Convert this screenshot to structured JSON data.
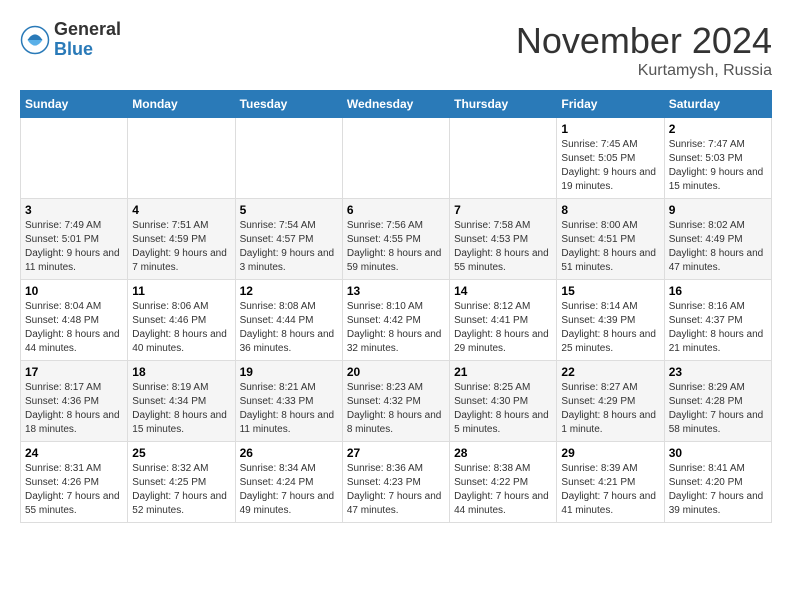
{
  "logo": {
    "general": "General",
    "blue": "Blue"
  },
  "title": "November 2024",
  "location": "Kurtamysh, Russia",
  "days_of_week": [
    "Sunday",
    "Monday",
    "Tuesday",
    "Wednesday",
    "Thursday",
    "Friday",
    "Saturday"
  ],
  "weeks": [
    [
      {
        "day": "",
        "info": ""
      },
      {
        "day": "",
        "info": ""
      },
      {
        "day": "",
        "info": ""
      },
      {
        "day": "",
        "info": ""
      },
      {
        "day": "",
        "info": ""
      },
      {
        "day": "1",
        "info": "Sunrise: 7:45 AM\nSunset: 5:05 PM\nDaylight: 9 hours and 19 minutes."
      },
      {
        "day": "2",
        "info": "Sunrise: 7:47 AM\nSunset: 5:03 PM\nDaylight: 9 hours and 15 minutes."
      }
    ],
    [
      {
        "day": "3",
        "info": "Sunrise: 7:49 AM\nSunset: 5:01 PM\nDaylight: 9 hours and 11 minutes."
      },
      {
        "day": "4",
        "info": "Sunrise: 7:51 AM\nSunset: 4:59 PM\nDaylight: 9 hours and 7 minutes."
      },
      {
        "day": "5",
        "info": "Sunrise: 7:54 AM\nSunset: 4:57 PM\nDaylight: 9 hours and 3 minutes."
      },
      {
        "day": "6",
        "info": "Sunrise: 7:56 AM\nSunset: 4:55 PM\nDaylight: 8 hours and 59 minutes."
      },
      {
        "day": "7",
        "info": "Sunrise: 7:58 AM\nSunset: 4:53 PM\nDaylight: 8 hours and 55 minutes."
      },
      {
        "day": "8",
        "info": "Sunrise: 8:00 AM\nSunset: 4:51 PM\nDaylight: 8 hours and 51 minutes."
      },
      {
        "day": "9",
        "info": "Sunrise: 8:02 AM\nSunset: 4:49 PM\nDaylight: 8 hours and 47 minutes."
      }
    ],
    [
      {
        "day": "10",
        "info": "Sunrise: 8:04 AM\nSunset: 4:48 PM\nDaylight: 8 hours and 44 minutes."
      },
      {
        "day": "11",
        "info": "Sunrise: 8:06 AM\nSunset: 4:46 PM\nDaylight: 8 hours and 40 minutes."
      },
      {
        "day": "12",
        "info": "Sunrise: 8:08 AM\nSunset: 4:44 PM\nDaylight: 8 hours and 36 minutes."
      },
      {
        "day": "13",
        "info": "Sunrise: 8:10 AM\nSunset: 4:42 PM\nDaylight: 8 hours and 32 minutes."
      },
      {
        "day": "14",
        "info": "Sunrise: 8:12 AM\nSunset: 4:41 PM\nDaylight: 8 hours and 29 minutes."
      },
      {
        "day": "15",
        "info": "Sunrise: 8:14 AM\nSunset: 4:39 PM\nDaylight: 8 hours and 25 minutes."
      },
      {
        "day": "16",
        "info": "Sunrise: 8:16 AM\nSunset: 4:37 PM\nDaylight: 8 hours and 21 minutes."
      }
    ],
    [
      {
        "day": "17",
        "info": "Sunrise: 8:17 AM\nSunset: 4:36 PM\nDaylight: 8 hours and 18 minutes."
      },
      {
        "day": "18",
        "info": "Sunrise: 8:19 AM\nSunset: 4:34 PM\nDaylight: 8 hours and 15 minutes."
      },
      {
        "day": "19",
        "info": "Sunrise: 8:21 AM\nSunset: 4:33 PM\nDaylight: 8 hours and 11 minutes."
      },
      {
        "day": "20",
        "info": "Sunrise: 8:23 AM\nSunset: 4:32 PM\nDaylight: 8 hours and 8 minutes."
      },
      {
        "day": "21",
        "info": "Sunrise: 8:25 AM\nSunset: 4:30 PM\nDaylight: 8 hours and 5 minutes."
      },
      {
        "day": "22",
        "info": "Sunrise: 8:27 AM\nSunset: 4:29 PM\nDaylight: 8 hours and 1 minute."
      },
      {
        "day": "23",
        "info": "Sunrise: 8:29 AM\nSunset: 4:28 PM\nDaylight: 7 hours and 58 minutes."
      }
    ],
    [
      {
        "day": "24",
        "info": "Sunrise: 8:31 AM\nSunset: 4:26 PM\nDaylight: 7 hours and 55 minutes."
      },
      {
        "day": "25",
        "info": "Sunrise: 8:32 AM\nSunset: 4:25 PM\nDaylight: 7 hours and 52 minutes."
      },
      {
        "day": "26",
        "info": "Sunrise: 8:34 AM\nSunset: 4:24 PM\nDaylight: 7 hours and 49 minutes."
      },
      {
        "day": "27",
        "info": "Sunrise: 8:36 AM\nSunset: 4:23 PM\nDaylight: 7 hours and 47 minutes."
      },
      {
        "day": "28",
        "info": "Sunrise: 8:38 AM\nSunset: 4:22 PM\nDaylight: 7 hours and 44 minutes."
      },
      {
        "day": "29",
        "info": "Sunrise: 8:39 AM\nSunset: 4:21 PM\nDaylight: 7 hours and 41 minutes."
      },
      {
        "day": "30",
        "info": "Sunrise: 8:41 AM\nSunset: 4:20 PM\nDaylight: 7 hours and 39 minutes."
      }
    ]
  ]
}
